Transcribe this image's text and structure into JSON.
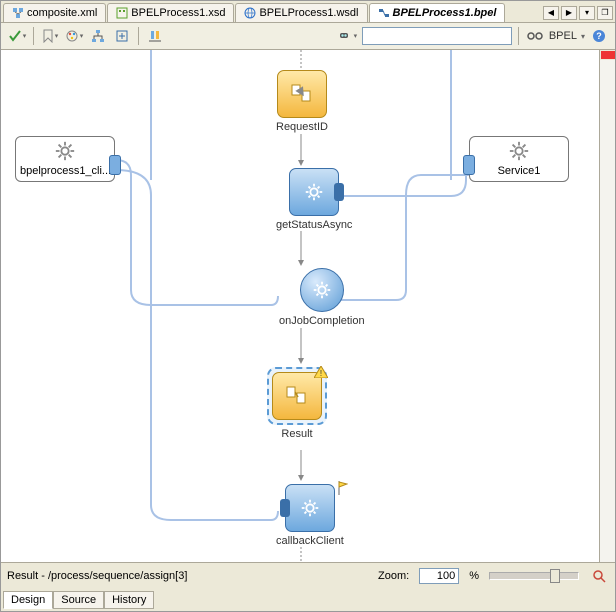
{
  "tabs": {
    "items": [
      {
        "label": "composite.xml"
      },
      {
        "label": "BPELProcess1.xsd"
      },
      {
        "label": "BPELProcess1.wsdl"
      },
      {
        "label": "BPELProcess1.bpel"
      }
    ],
    "active_index": 3
  },
  "toolbar": {
    "search_placeholder": "",
    "mode_label": "BPEL"
  },
  "partners": {
    "left": {
      "label": "bpelprocess1_cli..."
    },
    "right": {
      "label": "Service1"
    }
  },
  "nodes": {
    "requestId": {
      "label": "RequestID"
    },
    "getStatus": {
      "label": "getStatusAsync"
    },
    "onJob": {
      "label": "onJobCompletion"
    },
    "result": {
      "label": "Result"
    },
    "callback": {
      "label": "callbackClient"
    }
  },
  "status": {
    "path": "Result - /process/sequence/assign[3]",
    "zoom_label": "Zoom:",
    "zoom_value": "100",
    "zoom_unit": "%"
  },
  "bottom_tabs": {
    "items": [
      "Design",
      "Source",
      "History"
    ],
    "active_index": 0
  }
}
